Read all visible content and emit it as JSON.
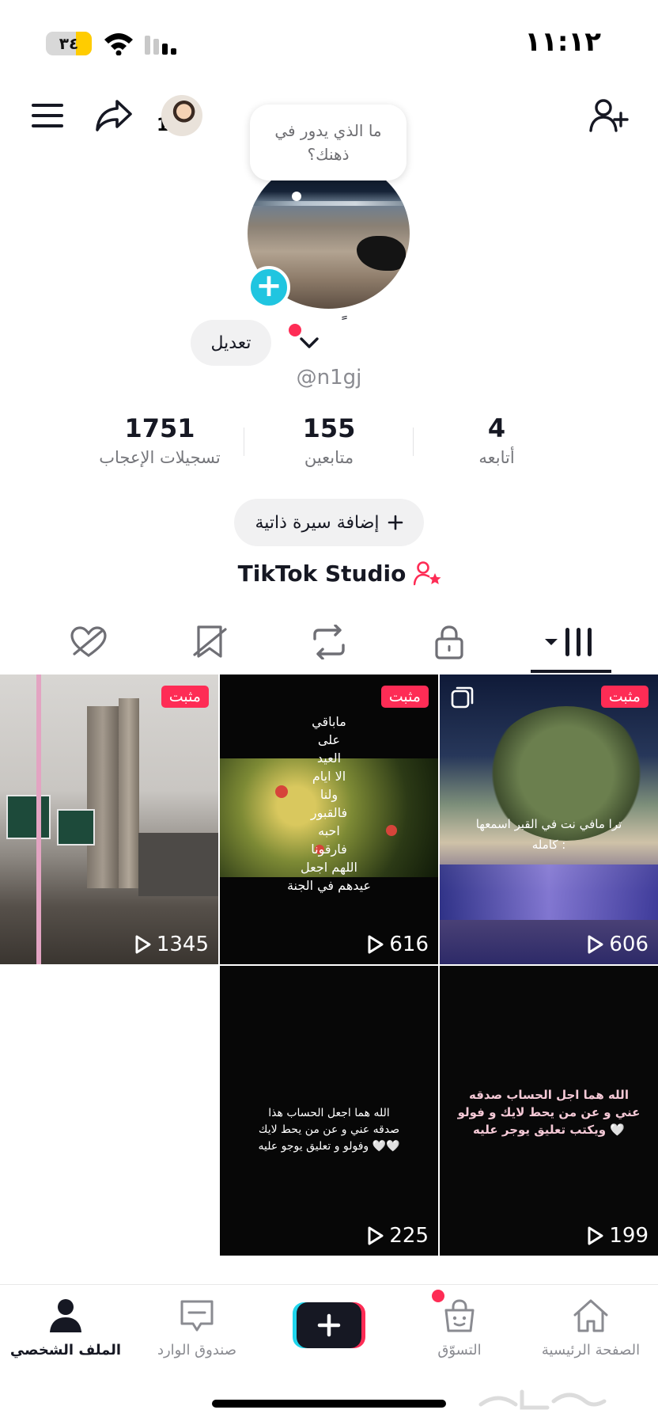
{
  "status_bar": {
    "battery": "٣٤",
    "battery_level": 0.34,
    "time": "١١:١٢"
  },
  "header": {
    "visitor_count": "1",
    "icons": [
      "menu-icon",
      "share-icon",
      "avatar",
      "add-friend-icon"
    ]
  },
  "profile": {
    "thought_bubble": "ما الذي يدور في ذهنك؟",
    "display_name": "ً",
    "username": "@n1gj",
    "edit_label": "تعديل"
  },
  "stats": {
    "likes": {
      "value": "1751",
      "label": "تسجيلات الإعجاب"
    },
    "followers": {
      "value": "155",
      "label": "متابعين"
    },
    "following": {
      "value": "4",
      "label": "أتابعه"
    }
  },
  "bio_button": {
    "label": "إضافة سيرة ذاتية",
    "icon": "plus-icon"
  },
  "studio": {
    "label": "TikTok Studio",
    "icon": "user-star-icon"
  },
  "tabs": [
    "liked-icon",
    "favorites-icon",
    "reposts-icon",
    "private-icon",
    "videos-grid-icon"
  ],
  "videos": [
    {
      "views": "606",
      "pinned": "مثبت",
      "caption": "ترا مافي نت في القبر اسمعها\nكامله :",
      "multi": true
    },
    {
      "views": "616",
      "pinned": "مثبت",
      "caption": "ماباقي\nعلى\nالعيد\nالا ايام\nولنا\nفالقبور\nاحبه\nفارقونا\nاللهم اجعل\nعيدهم في الجنة"
    },
    {
      "views": "1345",
      "pinned": "مثبت",
      "caption": ""
    },
    {
      "views": "199",
      "caption": "الله هما اجل الحساب صدقه\nعني و عن من يحط لايك و فولو\nويكتب تعليق يوجر عليه 🤍"
    },
    {
      "views": "225",
      "caption": "الله هما اجعل الحساب هذا\nصدقه عني و عن من يحط لايك\nوفولو و تعليق يوجو عليه 🤍🤍"
    }
  ],
  "bottom_nav": {
    "home": "الصفحة الرئيسية",
    "shop": "التسوّق",
    "inbox": "صندوق الوارد",
    "profile": "الملف الشخصي"
  },
  "colors": {
    "accent": "#fe2c55",
    "cyan": "#20c5e0",
    "text": "#161823"
  }
}
